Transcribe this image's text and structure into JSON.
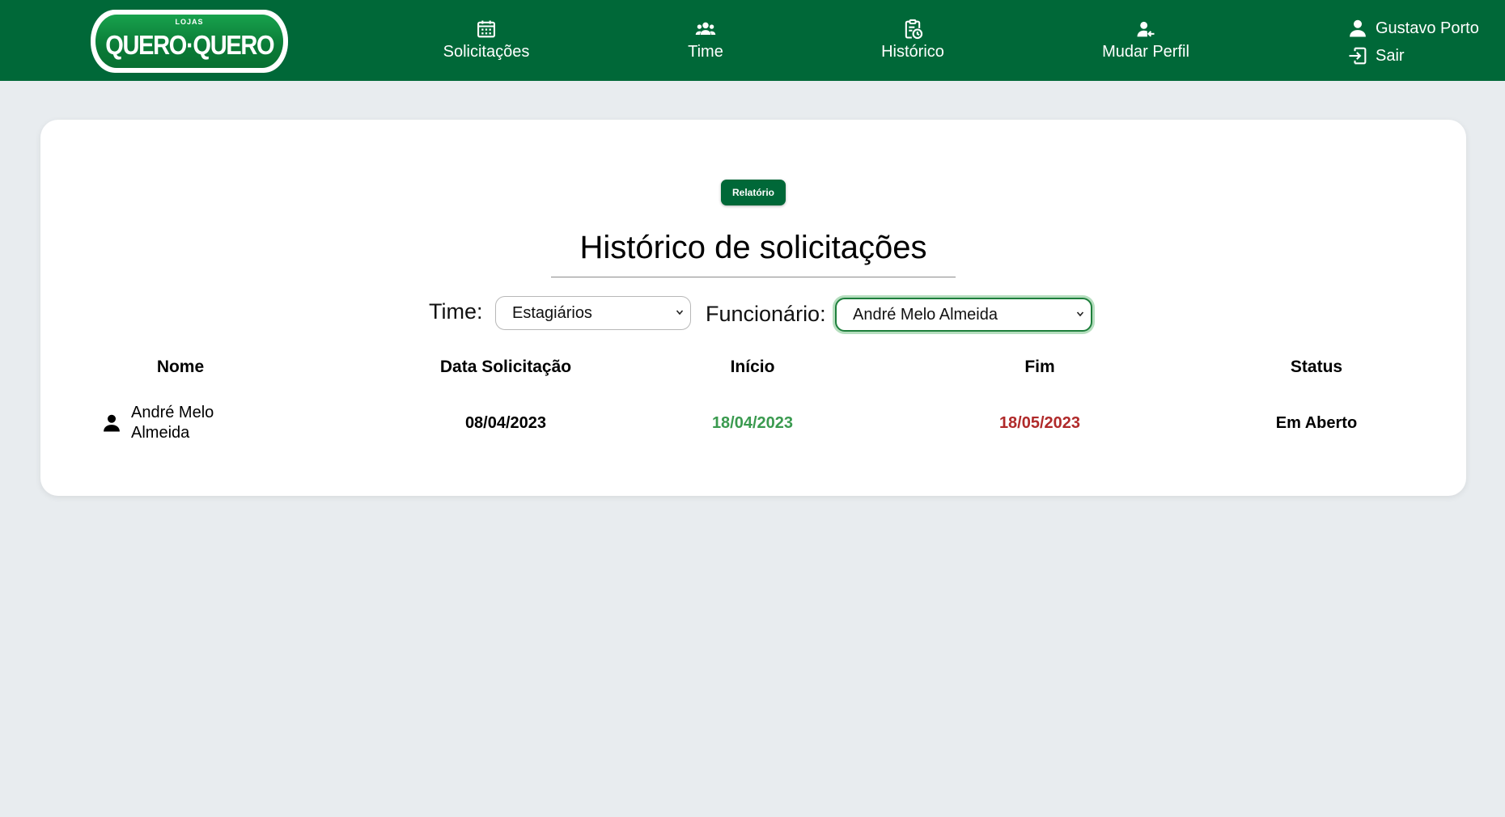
{
  "header": {
    "logo": {
      "top_text": "LOJAS",
      "main_text": "QUERO·QUERO"
    },
    "nav": [
      {
        "id": "solicitacoes",
        "label": "Solicitações",
        "icon": "calendar-icon"
      },
      {
        "id": "time",
        "label": "Time",
        "icon": "team-icon"
      },
      {
        "id": "historico",
        "label": "Histórico",
        "icon": "history-clipboard-icon"
      },
      {
        "id": "mudar-perfil",
        "label": "Mudar Perfil",
        "icon": "switch-user-icon"
      }
    ],
    "user": {
      "name": "Gustavo Porto",
      "logout_label": "Sair"
    }
  },
  "colors": {
    "header_bg": "#006838",
    "page_bg": "#e8ecef",
    "start_date": "#3a9a4f",
    "end_date": "#b02a2a"
  },
  "main": {
    "report_button": "Relatório",
    "title": "Histórico de solicitações",
    "filters": {
      "team_label": "Time:",
      "team_value": "Estagiários",
      "employee_label": "Funcionário:",
      "employee_value": "André Melo Almeida"
    },
    "table": {
      "columns": [
        "Nome",
        "Data Solicitação",
        "Início",
        "Fim",
        "Status"
      ],
      "rows": [
        {
          "name": "André Melo Almeida",
          "request_date": "08/04/2023",
          "start": "18/04/2023",
          "end": "18/05/2023",
          "status": "Em Aberto"
        }
      ]
    }
  }
}
